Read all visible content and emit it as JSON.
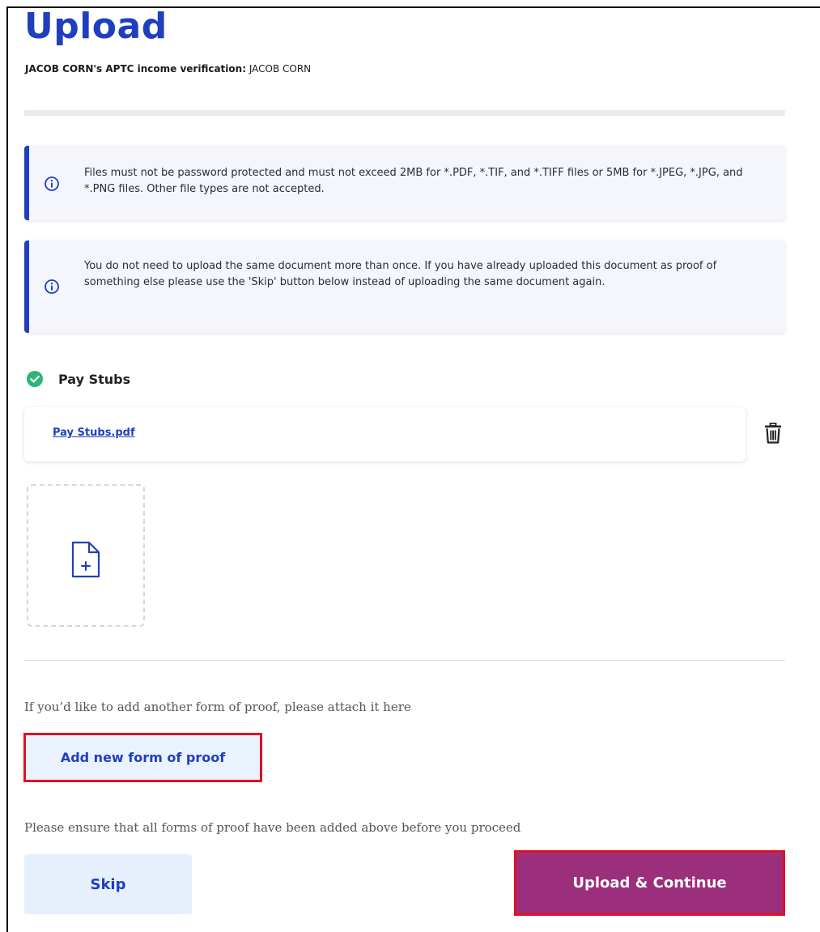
{
  "header": {
    "title": "Upload",
    "subtitle_label": "JACOB CORN's APTC income verification:",
    "subtitle_value": " JACOB CORN"
  },
  "alerts": [
    {
      "icon": "info-icon",
      "text": "Files must not be password protected and must not exceed 2MB for *.PDF, *.TIF, and *.TIFF files or 5MB for *.JPEG, *.JPG, and *.PNG files. Other file types are not accepted."
    },
    {
      "icon": "info-icon",
      "text": "You do not need to upload the same document more than once. If you have already uploaded this document as proof of something else please use the 'Skip' button below instead of uploading the same document again."
    }
  ],
  "document": {
    "status_icon": "check-circle-icon",
    "label": "Pay Stubs",
    "files": [
      {
        "name": "Pay Stubs.pdf",
        "action_icon": "trash-icon"
      }
    ],
    "add_file_icon": "add-file-icon"
  },
  "proof": {
    "prompt": "If you’d like to add another form of proof, please attach it here",
    "add_label": "Add new form of proof"
  },
  "footer": {
    "prompt": "Please ensure that all forms of proof have been added above before you proceed",
    "skip_label": "Skip",
    "continue_label": "Upload & Continue"
  },
  "colors": {
    "brand_blue": "#1f3fbf",
    "primary_button": "#9b2f7c",
    "highlight_outline": "#e01020",
    "success_green": "#2bb673"
  }
}
